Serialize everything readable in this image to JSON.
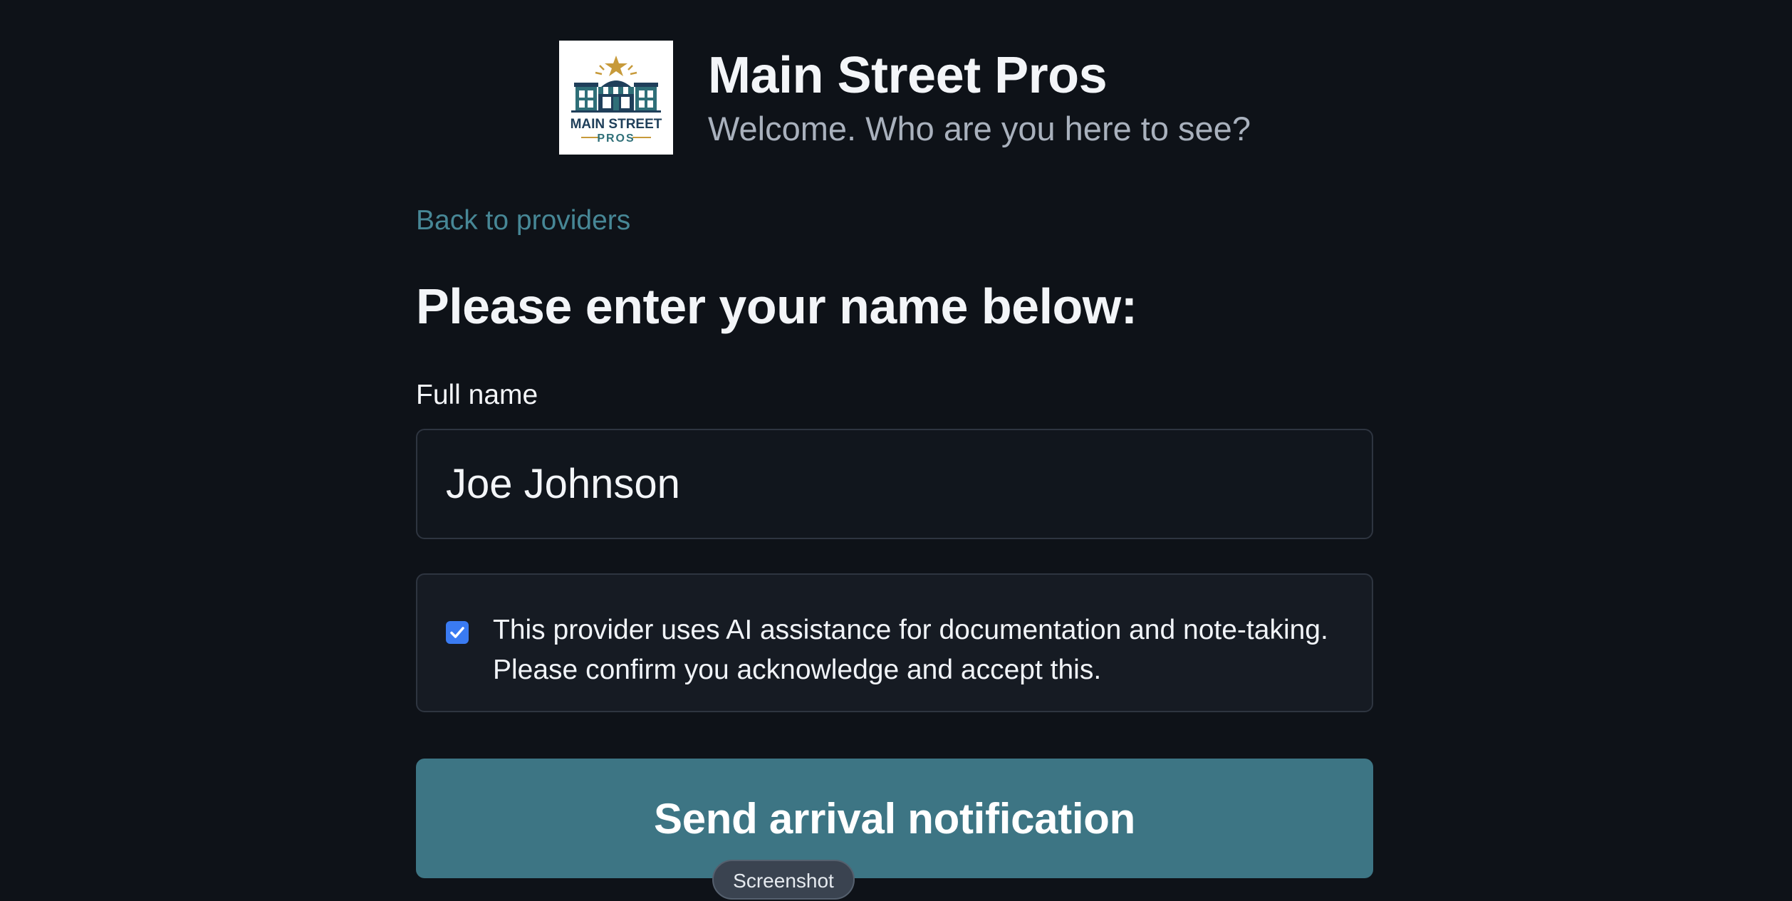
{
  "header": {
    "logo": {
      "name": "main-street-pros-logo",
      "line1": "MAIN STREET",
      "line2": "PROS"
    },
    "title": "Main Street Pros",
    "subtitle": "Welcome. Who are you here to see?"
  },
  "main": {
    "back_link": "Back to providers",
    "heading": "Please enter your name below:",
    "name_field": {
      "label": "Full name",
      "value": "Joe Johnson"
    },
    "consent": {
      "checked": true,
      "line1": "This provider uses AI assistance for documentation and note-taking.",
      "line2": "Please confirm you acknowledge and accept this."
    },
    "submit_label": "Send arrival notification"
  },
  "overlay": {
    "screenshot_label": "Screenshot"
  },
  "colors": {
    "background": "#0e1218",
    "accent": "#3d7584",
    "link": "#478796",
    "checkbox": "#3a7bf2"
  }
}
